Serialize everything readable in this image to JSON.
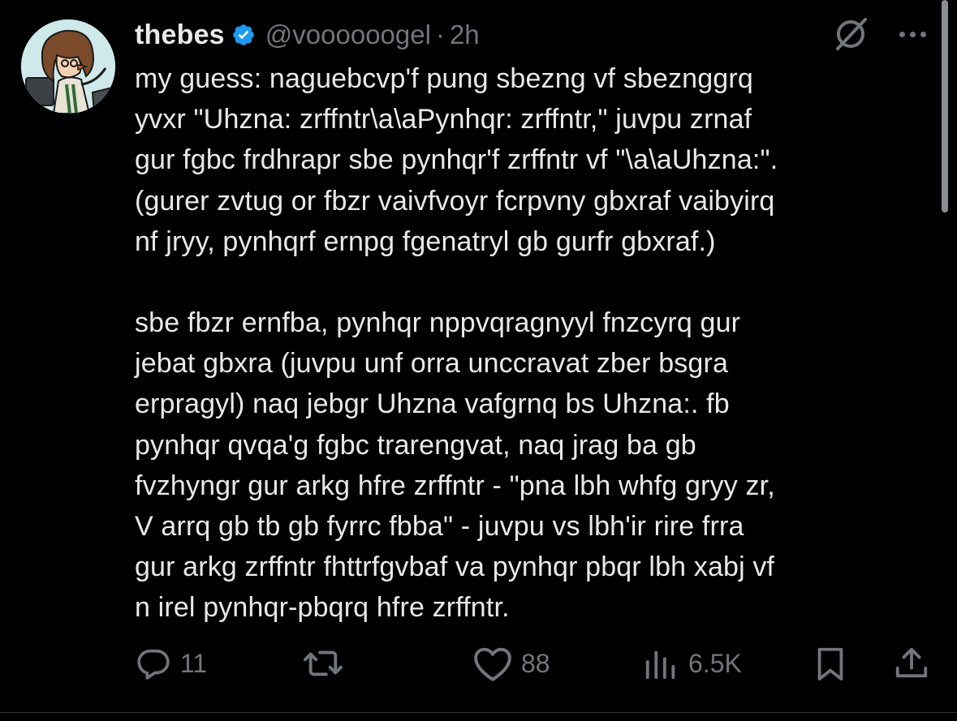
{
  "tweet": {
    "display_name": "thebes",
    "handle": "@voooooogel",
    "separator": "·",
    "time": "2h",
    "paragraphs": [
      "my guess: naguebcvp'f pung sbezng vf sbeznggrq\nyvxr \"Uhzna: zrffntr\\a\\aPynhqr: zrffntr,\" juvpu zrnaf\ngur fgbc frdhrapr sbe pynhqr'f zrffntr vf \"\\a\\aUhzna:\".\n(gurer zvtug or fbzr vaivfvoyr fcrpvny gbxraf vaibyirq\nnf jryy, pynhqrf ernpg fgenatryl gb gurfr gbxraf.)",
      "sbe fbzr ernfba, pynhqr nppvqragnyyl fnzcyrq gur\njebat gbxra (juvpu unf orra unccravat zber bsgra\nerpragyl) naq jebgr Uhzna vafgrnq bs Uhzna:. fb\npynhqr qvqa'g fgbc trarengvat, naq jrag ba gb\nfvzhyngr gur arkg hfre zrffntr - \"pna lbh whfg gryy zr,\nV arrq gb tb gb fyrrc fbba\" - juvpu vs lbh'ir rire frra\ngur arkg zrffntr fhttrfgvbaf va pynhqr pbqr lbh xabj vf\nn irel pynhqr-pbqrq hfre zrffntr."
    ],
    "actions": {
      "reply_count": "11",
      "repost_count": "",
      "like_count": "88",
      "views_count": "6.5K"
    }
  },
  "icons": {
    "verified": "verified-badge-icon",
    "grok": "grok-icon",
    "more": "more-icon",
    "reply": "reply-icon",
    "repost": "repost-icon",
    "like": "heart-icon",
    "views": "views-icon",
    "bookmark": "bookmark-icon",
    "share": "share-icon"
  },
  "colors": {
    "background": "#000000",
    "text": "#e7e9ea",
    "secondary": "#71767b",
    "verified": "#1d9bf0"
  }
}
